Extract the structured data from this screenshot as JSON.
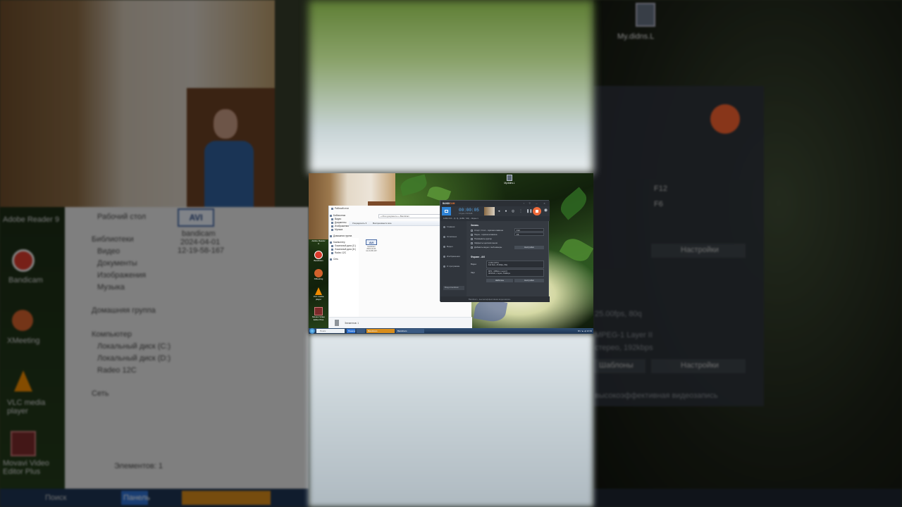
{
  "screen": {
    "explorer": {
      "address": "« Мои документы » Bandicam",
      "toolbar": [
        "Упорядочить ▾",
        "Воспроизвести все"
      ],
      "nav": [
        "Рабочий стол",
        "Библиотеки",
        "Видео",
        "Документы",
        "Изображения",
        "Музыка",
        "Домашняя группа",
        "Компьютер",
        "Локальный диск (C:)",
        "Локальный диск (D:)",
        "Radeo 12C",
        "Сеть"
      ],
      "file": {
        "badge": "AVI",
        "name": "bandicam",
        "date": "2024-04-01",
        "time": "12-19-58-167"
      },
      "status": "Элементов: 1"
    },
    "desktop_icons": [
      {
        "label": "Adobe Reader 9",
        "icon": "adobe-reader-icon",
        "color": "#b3201d"
      },
      {
        "label": "Bandicam",
        "icon": "bandicam-icon",
        "color": "#d93a2c"
      },
      {
        "label": "XMeeting",
        "icon": "xmeeting-icon",
        "color": "#d2612c"
      },
      {
        "label": "VLC media player",
        "icon": "vlc-icon",
        "color": "#f08a00"
      },
      {
        "label": "Movavi Video Editor Plus",
        "icon": "movavi-icon",
        "color": "#7a2a2a"
      }
    ],
    "my_capture_label": "My.didns.L",
    "bandicam": {
      "logo_a": "BANDI",
      "logo_b": "CAM",
      "timer": "00:00:05",
      "size": "0 bytes / 50.6GB",
      "path": "1280x720 - (0, 0), (1280, 720) - Экран 1",
      "sidebar": [
        "Главная",
        "Основные",
        "Видео",
        "Изображения",
        "О программе"
      ],
      "sidebar_button": "Вход в bandicam",
      "record_heading": "Запись",
      "checks": [
        "Старт / Стоп - горячая клавиша",
        "Пауза - горячая клавиша",
        "Показывать курсор",
        "Эффекты щелчков мыши",
        "Добавить видео с веб-камеры"
      ],
      "hotkey_1": "F12",
      "hotkey_2": "F6",
      "settings_button": "Настройки",
      "format_heading": "Формат - AVI",
      "video_label": "Видео",
      "video_lines": [
        "H.264 (CPU)",
        "Full Size, 25.00fps, 80q"
      ],
      "audio_label": "Звук",
      "audio_lines": [
        "MP2 - MPEG-1 Layer II",
        "48.0KHz, стерео, 192kbps"
      ],
      "templates_button": "Шаблоны",
      "settings_button_2": "Настройки",
      "footer": "Bandicam - высокоэффективная видеозапись"
    },
    "taskbar": {
      "search": "Поиск",
      "items": [
        "Панель",
        "",
        "Bandicam",
        "Bandicam"
      ],
      "tray": "RU  ▲  ◂)  12:19"
    }
  },
  "backdrop": {
    "left": {
      "nav": [
        "Рабочий стол",
        "Библиотеки",
        "Видео",
        "Документы",
        "Изображения",
        "Музыка",
        "Домашняя группа",
        "Компьютер",
        "Локальный диск (C:)",
        "Локальный диск (D:)",
        "Radeo 12C",
        "Сеть"
      ],
      "file_badge": "AVI",
      "file_name": "bandicam",
      "file_date": "2024-04-01",
      "file_time": "12-19-58-167",
      "status": "Элементов: 1",
      "icons": [
        "Adobe Reader 9",
        "Bandicam",
        "XMeeting",
        "VLC media player",
        "Movavi Video Editor Plus"
      ],
      "taskbar_search": "Поиск",
      "taskbar_item": "Панель"
    },
    "right": {
      "my_capture": "My.didns.L",
      "hotkey_1": "F12",
      "hotkey_2": "F6",
      "settings_button": "Настройки",
      "video_line": "25.00fps, 80q",
      "audio_line_1": "MPEG-1 Layer II",
      "audio_line_2": "стерео, 192kbps",
      "templates_button": "Шаблоны",
      "settings_button_2": "Настройки",
      "footer": "высокоэффективная видеозапись"
    }
  },
  "colors": {
    "bandicam_accent": "#ef6a3a",
    "bandicam_blue": "#2e83d6",
    "taskbar": "#1f3553"
  }
}
